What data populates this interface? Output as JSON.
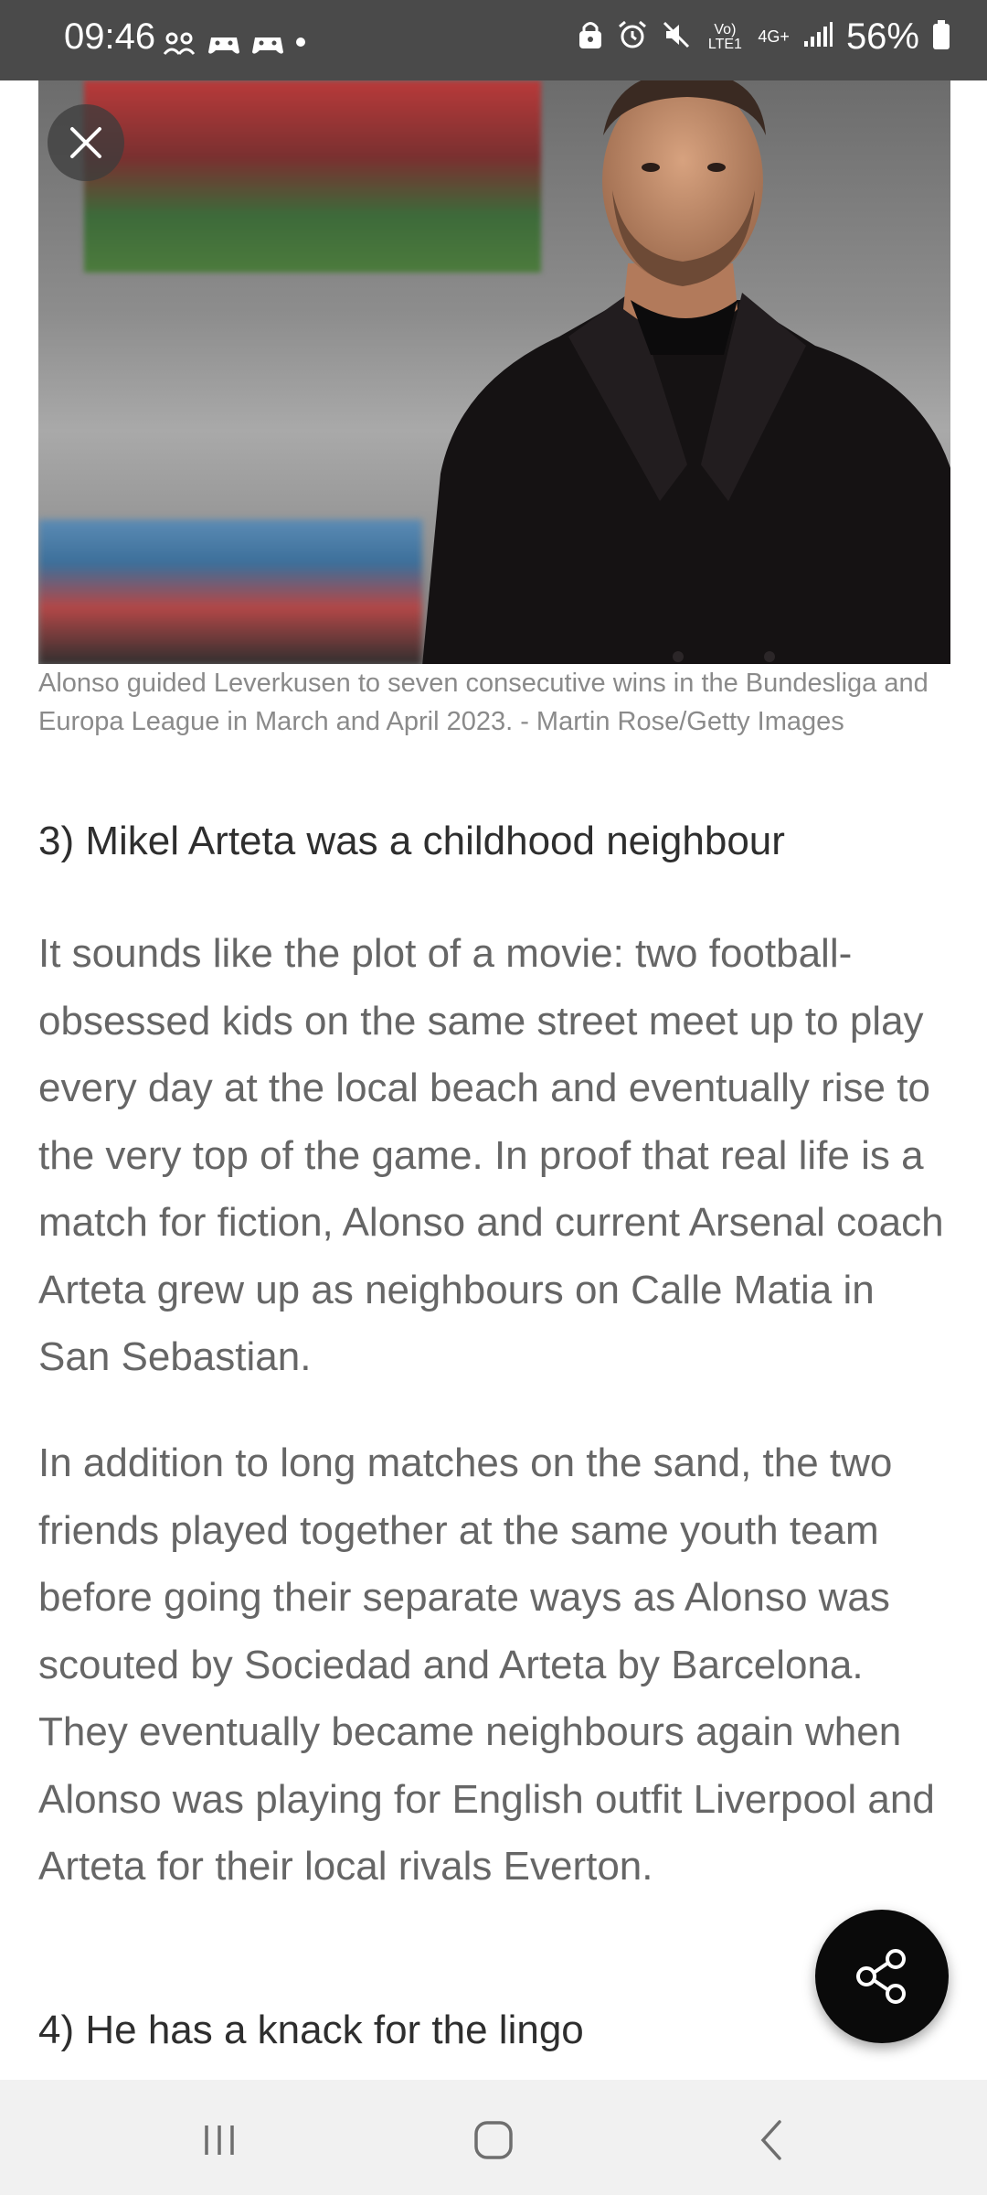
{
  "status_bar": {
    "time": "09:46",
    "battery": "56%",
    "network": "4G+",
    "volte": "Vo) LTE1",
    "left_icons": [
      "group-icon",
      "game-controller-icon",
      "game-controller-icon",
      "dot-icon"
    ],
    "right_icons": [
      "lock-icon",
      "alarm-icon",
      "mute-icon",
      "volte-icon",
      "network-4g-icon",
      "signal-icon",
      "battery-icon"
    ]
  },
  "article": {
    "image_caption": "Alonso guided Leverkusen to seven consecutive wins in the Bundesliga and Europa League in March and April 2023. - Martin Rose/Getty Images",
    "section3_heading": "3) Mikel Arteta was a childhood neighbour",
    "section3_para1": "It sounds like the plot of a movie: two football-obsessed kids on the same street meet up to play every day at the local beach and eventually rise to the very top of the game. In proof that real life is a match for fiction, Alonso and current Arsenal coach Arteta grew up as neighbours on Calle Matia in San Sebastian.",
    "section3_para2": "In addition to long matches on the sand, the two friends played together at the same youth team before going their separate ways as Alonso was scouted by Sociedad and Arteta by Barcelona. They eventually became neighbours again when Alonso was playing for English outfit Liverpool and Arteta for their local rivals Everton.",
    "section4_heading": "4) He has a knack for the lingo"
  },
  "controls": {
    "close_icon": "close-icon",
    "share_icon": "share-icon"
  },
  "nav_bar": {
    "buttons": [
      "recent-apps-icon",
      "home-icon",
      "back-icon"
    ]
  },
  "colors": {
    "status_bar_bg": "#4a4a4a",
    "fab_bg": "#0a0a0a",
    "nav_bg": "#f1f1f1",
    "heading_text": "#2e2e2e",
    "body_text": "#666666",
    "caption_text": "#8a8a8a"
  }
}
